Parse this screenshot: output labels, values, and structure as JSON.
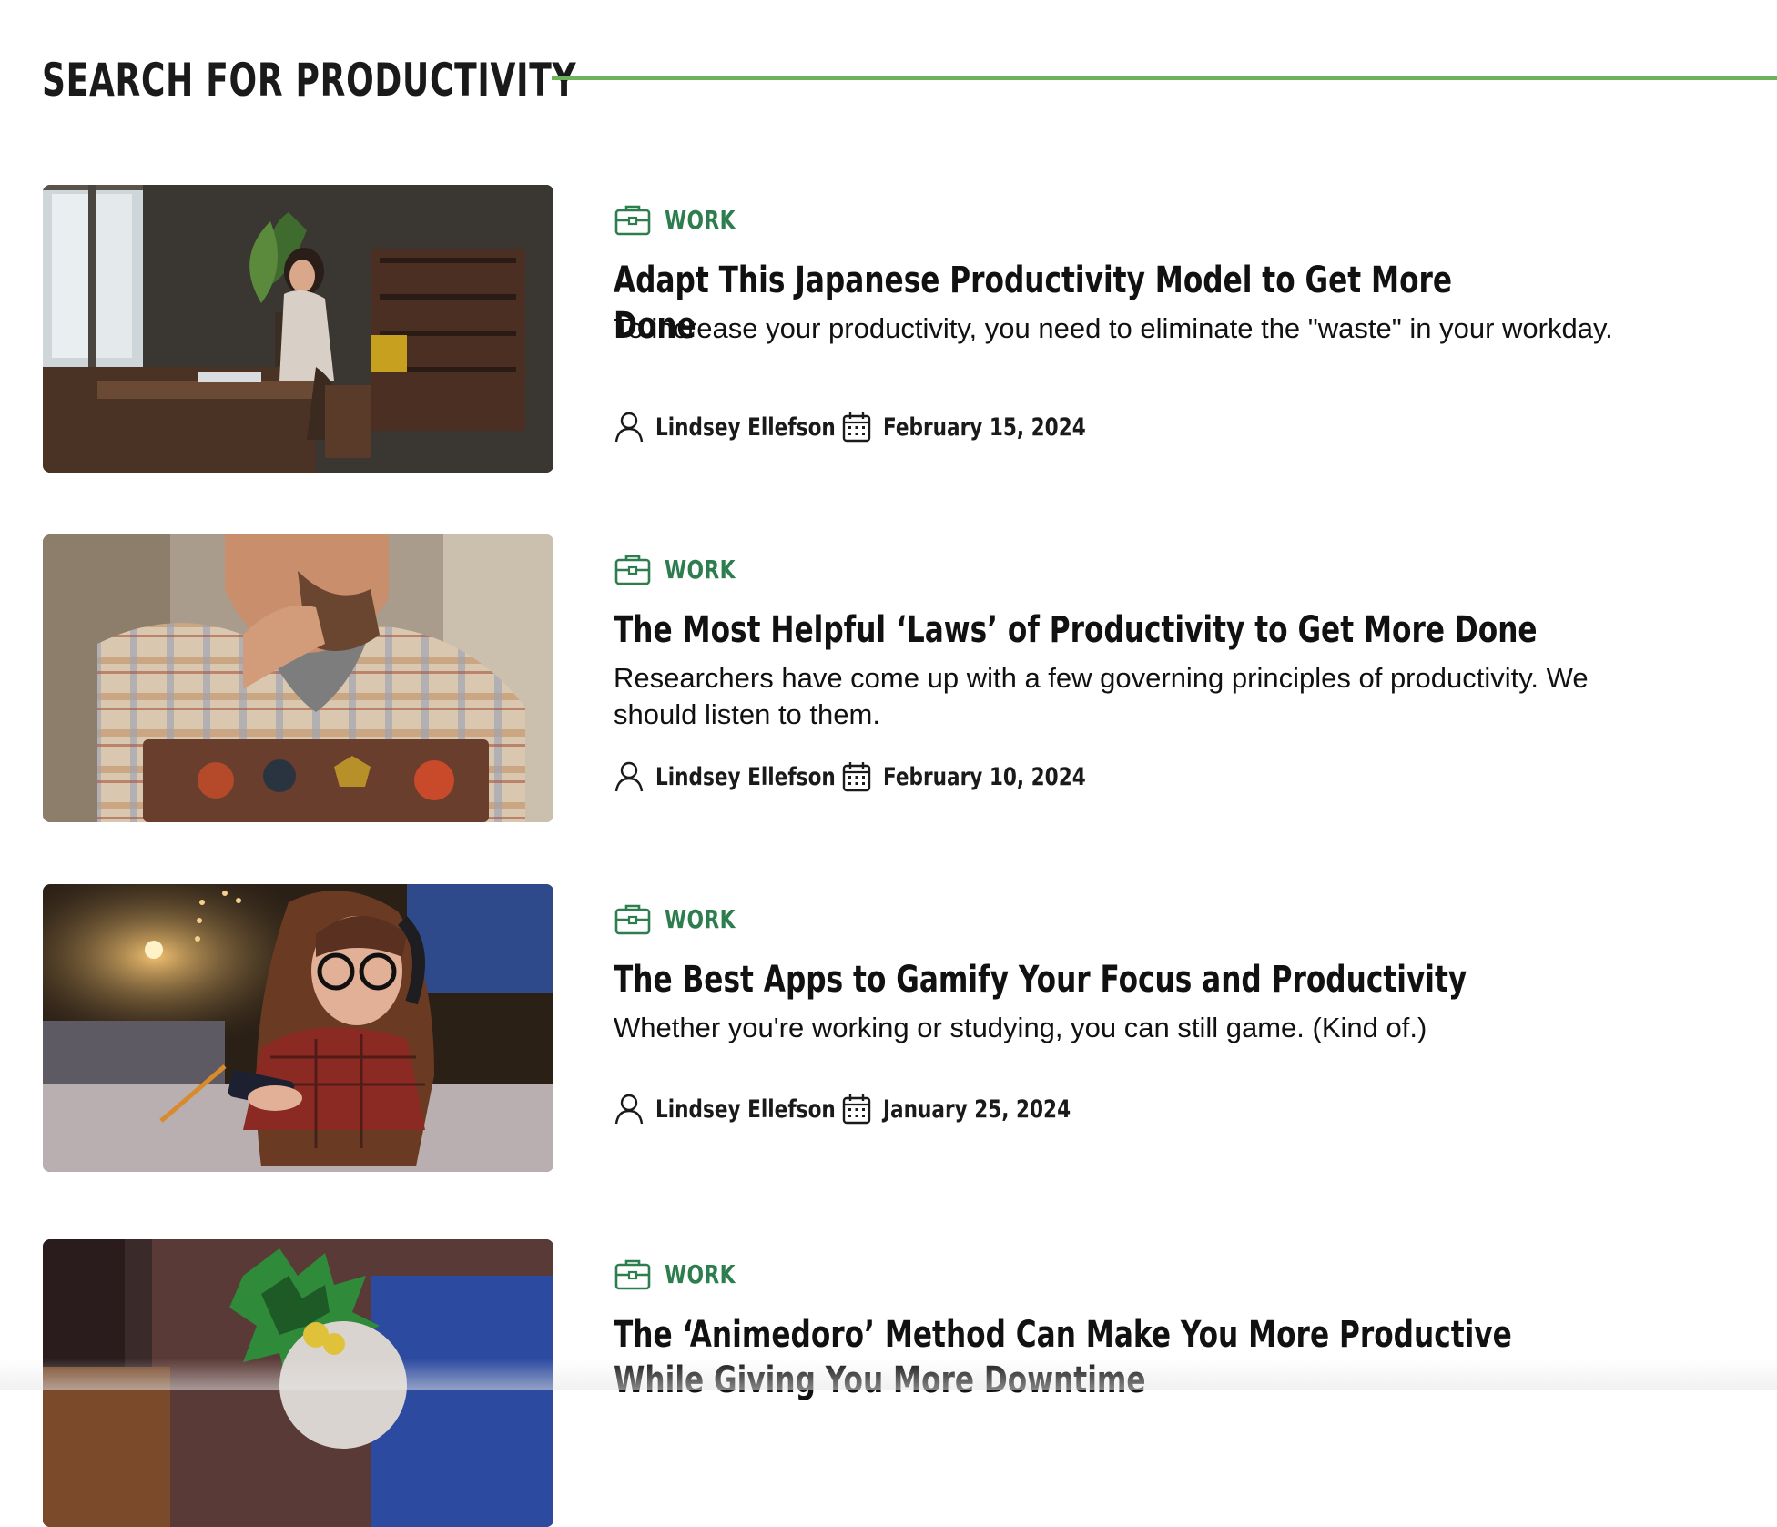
{
  "page": {
    "title": "SEARCH FOR PRODUCTIVITY",
    "accent_color": "#6db35b",
    "category_color": "#2e7d4f"
  },
  "articles": [
    {
      "category": "WORK",
      "category_icon": "briefcase-icon",
      "headline": "Adapt This Japanese Productivity Model to Get More Done",
      "summary": "To increase your productivity, you need to eliminate the \"waste\" in your workday.",
      "author": "Lindsey Ellefson",
      "date": "February 15, 2024",
      "image_alt": "Woman on the phone at a desk by a window with a laptop"
    },
    {
      "category": "WORK",
      "category_icon": "briefcase-icon",
      "headline": "The Most Helpful ‘Laws’ of Productivity to Get More Done",
      "summary": "Researchers have come up with a few governing principles of productivity. We should listen to them.",
      "author": "Lindsey Ellefson",
      "date": "February 10, 2024",
      "image_alt": "Bearded man in a plaid shirt thinking behind a laptop with stickers"
    },
    {
      "category": "WORK",
      "category_icon": "briefcase-icon",
      "headline": "The Best Apps to Gamify Your Focus and Productivity",
      "summary": "Whether you're working or studying, you can still game. (Kind of.)",
      "author": "Lindsey Ellefson",
      "date": "January 25, 2024",
      "image_alt": "Young woman with headphones and glasses looking at a phone"
    },
    {
      "category": "WORK",
      "category_icon": "briefcase-icon",
      "headline": "The ‘Animedoro’ Method Can Make You More Productive While Giving You More Downtime",
      "summary": "",
      "author": "",
      "date": "",
      "image_alt": "Anime character with green hair"
    }
  ]
}
